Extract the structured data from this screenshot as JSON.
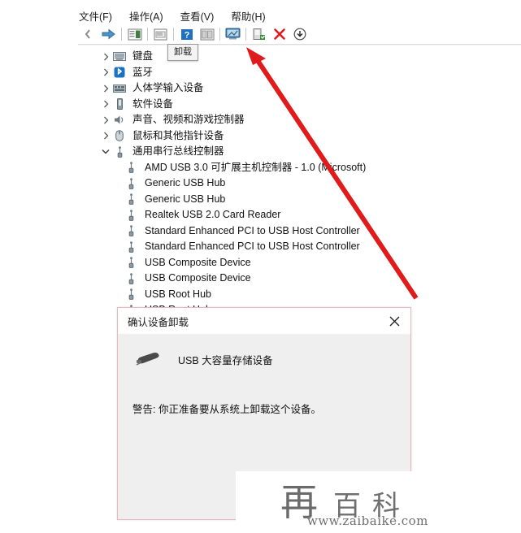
{
  "menubar": {
    "items": [
      {
        "label": "文件(F)",
        "name": "menu-file"
      },
      {
        "label": "操作(A)",
        "name": "menu-action"
      },
      {
        "label": "查看(V)",
        "name": "menu-view"
      },
      {
        "label": "帮助(H)",
        "name": "menu-help"
      }
    ]
  },
  "toolbar": {
    "buttons": [
      {
        "icon": "back-arrow-icon",
        "label": "后退"
      },
      {
        "icon": "forward-arrow-icon",
        "label": "前进"
      },
      {
        "icon": "show-hidden-devices-icon",
        "label": "显示隐藏的设备"
      },
      {
        "icon": "properties-icon",
        "label": "属性"
      },
      {
        "icon": "help-icon",
        "label": "帮助"
      },
      {
        "icon": "update-driver-icon",
        "label": "更新驱动程序"
      },
      {
        "icon": "scan-hardware-icon",
        "label": "扫描检测硬件改动"
      },
      {
        "icon": "enable-device-icon",
        "label": "启用设备"
      },
      {
        "icon": "uninstall-icon",
        "label": "卸载"
      },
      {
        "icon": "download-icon",
        "label": "下载"
      }
    ]
  },
  "tooltip": {
    "text": "卸载"
  },
  "tree": {
    "categories": [
      {
        "label": "键盘",
        "icon": "keyboard-icon",
        "expanded": false
      },
      {
        "label": "蓝牙",
        "icon": "bluetooth-icon",
        "expanded": false
      },
      {
        "label": "人体学输入设备",
        "icon": "hid-icon",
        "expanded": false
      },
      {
        "label": "软件设备",
        "icon": "software-device-icon",
        "expanded": false
      },
      {
        "label": "声音、视频和游戏控制器",
        "icon": "sound-video-game-icon",
        "expanded": false
      },
      {
        "label": "鼠标和其他指针设备",
        "icon": "mouse-icon",
        "expanded": false
      },
      {
        "label": "通用串行总线控制器",
        "icon": "usb-controller-icon",
        "expanded": true
      }
    ],
    "usb_devices": [
      {
        "label": "AMD USB 3.0 可扩展主机控制器 - 1.0 (Microsoft)",
        "selected": false
      },
      {
        "label": "Generic USB Hub",
        "selected": false
      },
      {
        "label": "Generic USB Hub",
        "selected": false
      },
      {
        "label": "Realtek USB 2.0 Card Reader",
        "selected": false
      },
      {
        "label": "Standard Enhanced PCI to USB Host Controller",
        "selected": false
      },
      {
        "label": "Standard Enhanced PCI to USB Host Controller",
        "selected": false
      },
      {
        "label": "USB Composite Device",
        "selected": false
      },
      {
        "label": "USB Composite Device",
        "selected": false
      },
      {
        "label": "USB Root Hub",
        "selected": false
      },
      {
        "label": "USB Root Hub",
        "selected": false
      },
      {
        "label": "USB 大容量存储设备",
        "selected": true
      }
    ]
  },
  "dialog": {
    "title": "确认设备卸载",
    "close_label": "✕",
    "device_name": "USB 大容量存储设备",
    "device_icon": "usb-storage-device-icon",
    "warning": "警告: 你正准备要从系统上卸载这个设备。"
  },
  "annotation": {
    "arrow_color": "#e01b1b",
    "arrow_name": "red-pointer-arrow"
  },
  "watermark": {
    "mark": "再",
    "name": "百科",
    "url": "www.zaibaike.com"
  },
  "colors": {
    "selection": "#cde8ff",
    "dialog_border": "#e4b8bd",
    "dialog_body": "#efefef",
    "accent_red": "#e01b1b"
  }
}
